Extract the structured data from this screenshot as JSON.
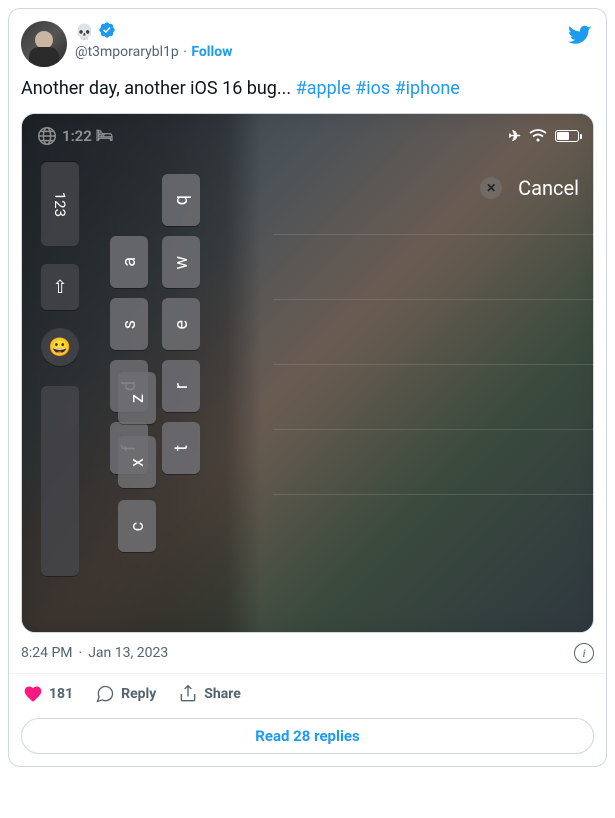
{
  "header": {
    "display_icon": "💀",
    "handle": "@t3mporarybl1p",
    "follow_label": "Follow",
    "sep_dot": "·"
  },
  "tweet": {
    "text_prefix": "Another day, another iOS 16 bug... ",
    "hashtags": [
      "#apple",
      "#ios",
      "#iphone"
    ]
  },
  "ios": {
    "time": "1:22",
    "cancel_label": "Cancel",
    "keys_top": [
      "q",
      "w",
      "e",
      "r",
      "t"
    ],
    "keys_mid": [
      "a",
      "s",
      "d",
      "f"
    ],
    "keys_bot": [
      "z",
      "x",
      "c"
    ],
    "key_123": "123",
    "shift_glyph": "⇧",
    "emoji_glyph": "😀"
  },
  "meta": {
    "time": "8:24 PM",
    "date": "Jan 13, 2023",
    "sep_dot": "·"
  },
  "actions": {
    "likes": "181",
    "reply_label": "Reply",
    "share_label": "Share",
    "read_replies": "Read 28 replies"
  }
}
